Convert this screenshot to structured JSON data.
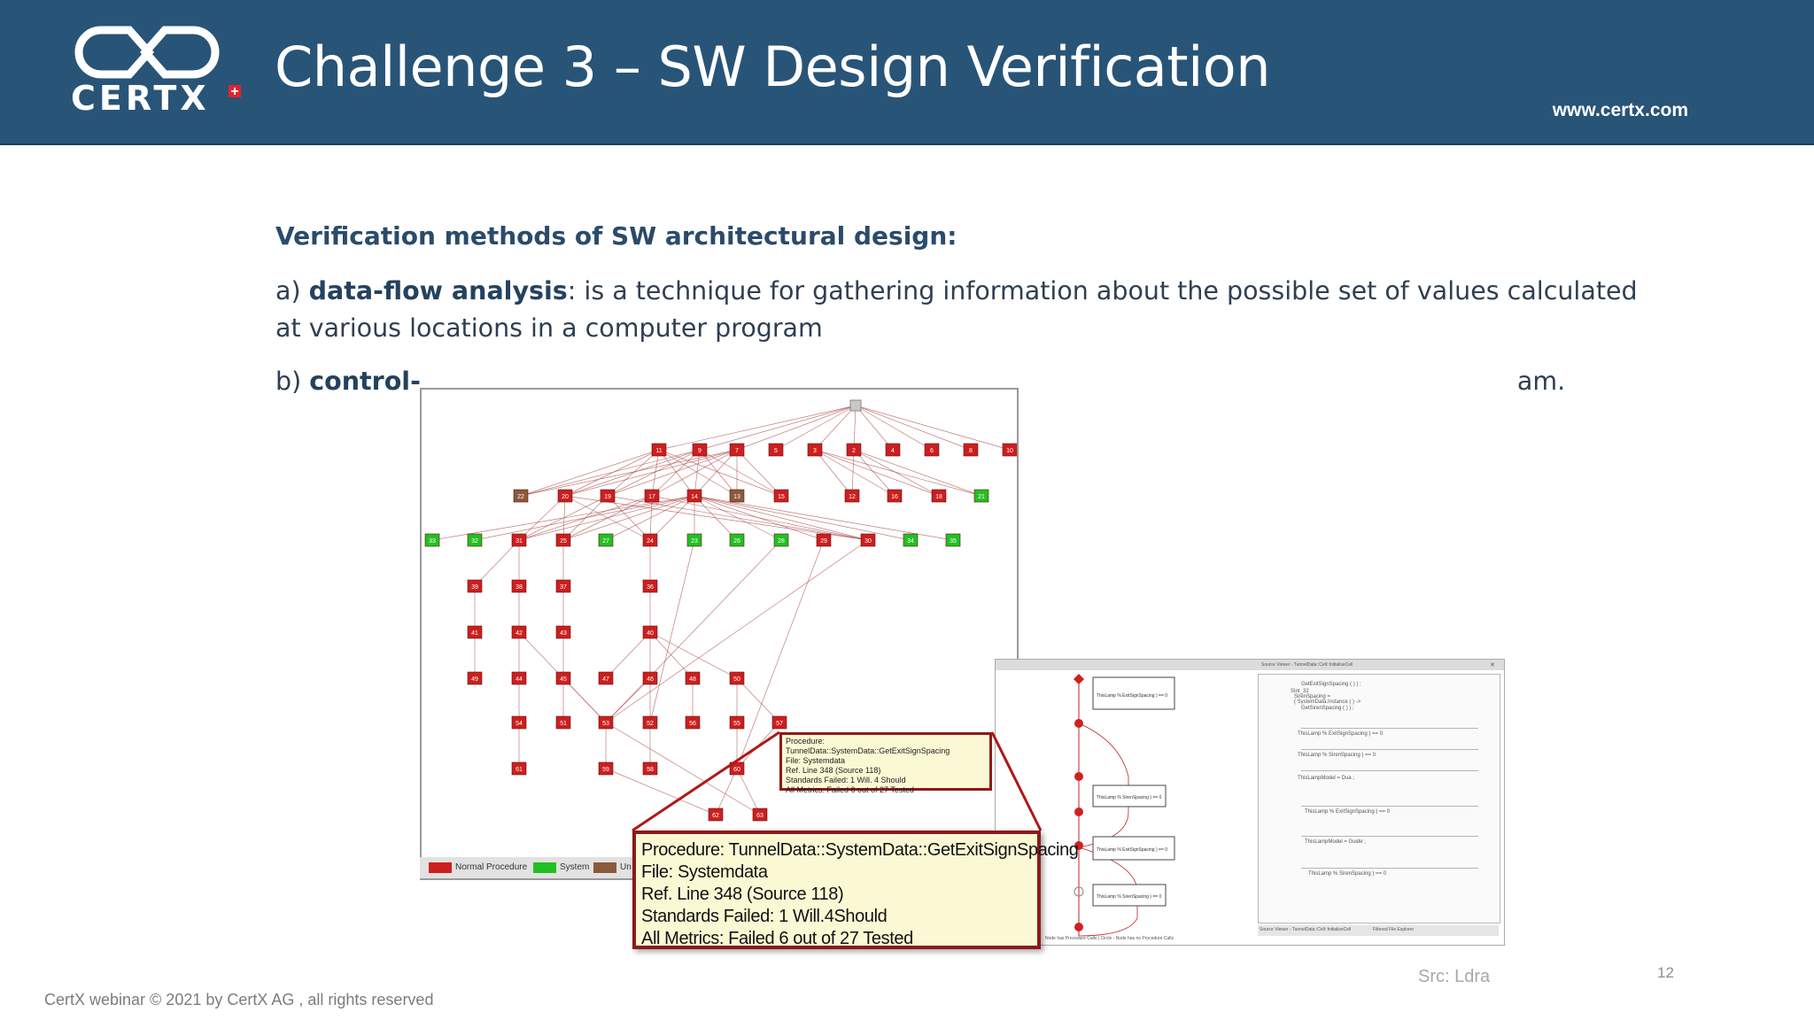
{
  "header": {
    "logo_text": "CERTX",
    "title": "Challenge 3 – SW Design Verification",
    "website": "www.certx.com"
  },
  "content": {
    "heading": "Verification methods of SW architectural design:",
    "item_a": {
      "prefix": "a) ",
      "term": "data-flow analysis",
      "text": ": is a technique for gathering information about the possible set of values calculated at various locations in a computer program"
    },
    "item_b": {
      "prefix": "b) ",
      "term": "control-",
      "text_end": "am."
    }
  },
  "graph": {
    "root_label": "",
    "rows": [
      [
        "11",
        "9",
        "7",
        "5",
        "3",
        "2",
        "4",
        "6",
        "8",
        "10"
      ],
      [
        "22",
        "20",
        "19",
        "17",
        "14",
        "13",
        "15",
        "12",
        "16",
        "18",
        "21"
      ],
      [
        "33",
        "32",
        "31",
        "25",
        "27",
        "24",
        "23",
        "26",
        "28",
        "29",
        "30",
        "34",
        "35"
      ],
      [
        "39",
        "38",
        "37",
        "36"
      ],
      [
        "41",
        "42",
        "43",
        "40"
      ],
      [
        "49",
        "44",
        "45",
        "47",
        "46",
        "48",
        "50"
      ],
      [
        "54",
        "51",
        "53",
        "52",
        "56",
        "55",
        "57"
      ],
      [
        "61",
        "59",
        "58",
        "60"
      ],
      [
        "62",
        "63"
      ]
    ],
    "green_nodes": [
      "21",
      "33",
      "32",
      "27",
      "23",
      "26",
      "28",
      "34",
      "35"
    ],
    "brown_nodes": [
      "22",
      "13"
    ],
    "colors": {
      "normal": "#cc1f1f",
      "system": "#22c022",
      "brown": "#8a5a3c"
    },
    "legend": [
      {
        "label": "Normal Procedure",
        "color": "#cc1f1f"
      },
      {
        "label": "System",
        "color": "#22c022"
      },
      {
        "label": "Un",
        "color": "#8a5a3c"
      }
    ]
  },
  "tooltip_small": {
    "procedure": "Procedure: TunnelData::SystemData::GetExitSignSpacing",
    "file": "File: Systemdata",
    "ref": "Ref. Line 348 (Source 118)",
    "standards": "Standards Failed:   1 Will. 4 Should",
    "metrics": "All Metrics: Failed 6 out of 27 Tested"
  },
  "tooltip_large": {
    "procedure": "Procedure: TunnelData::SystemData::GetExitSignSpacing",
    "file": "File: Systemdata",
    "ref": "Ref. Line 348 (Source 118)",
    "standards": "Standards Failed:   1 Will.4Should",
    "metrics": "All Metrics: Failed 6 out of 27 Tested"
  },
  "code_panel": {
    "title": "Source Viewer - TunnelData::Cell::InitialiseCell",
    "flow_boxes": [
      "ThisLamp % ExitSignSpacing ) == 0",
      "ThisLamp % SirenSpacing ) == 0",
      "ThisLamp % ExitSignSpacing ) == 0",
      "ThisLamp % SirenSpacing ) == 0"
    ],
    "lines": [
      "GetExitSignSpacing ( ) ) ;",
      "SInt_32",
      "SirenSpacing =",
      "( SystemData.Instance ( ) ->",
      "GetSirenSpacing ( ) ) ;",
      "ThisLamp % ExitSignSpacing ) == 0",
      "ThisLamp % SirenSpacing ) == 0",
      "ThisLampModel = Dua ;",
      "ThisLamp % ExitSignSpacing ) == 0",
      "ThisLampModel = Guide ;",
      "ThisLamp % SirenSpacing ) == 0"
    ],
    "status_bar": "Node has Procedure Calls | Circle - Node has no Procedure Calls",
    "tabs": [
      "Source Viewer - TunnelData::Cell::InitialiseCell",
      "Filtered File Explorer"
    ]
  },
  "source_note": "Src: Ldra",
  "slide_number": "12",
  "footer": "CertX webinar © 2021 by CertX AG ,  all rights reserved"
}
